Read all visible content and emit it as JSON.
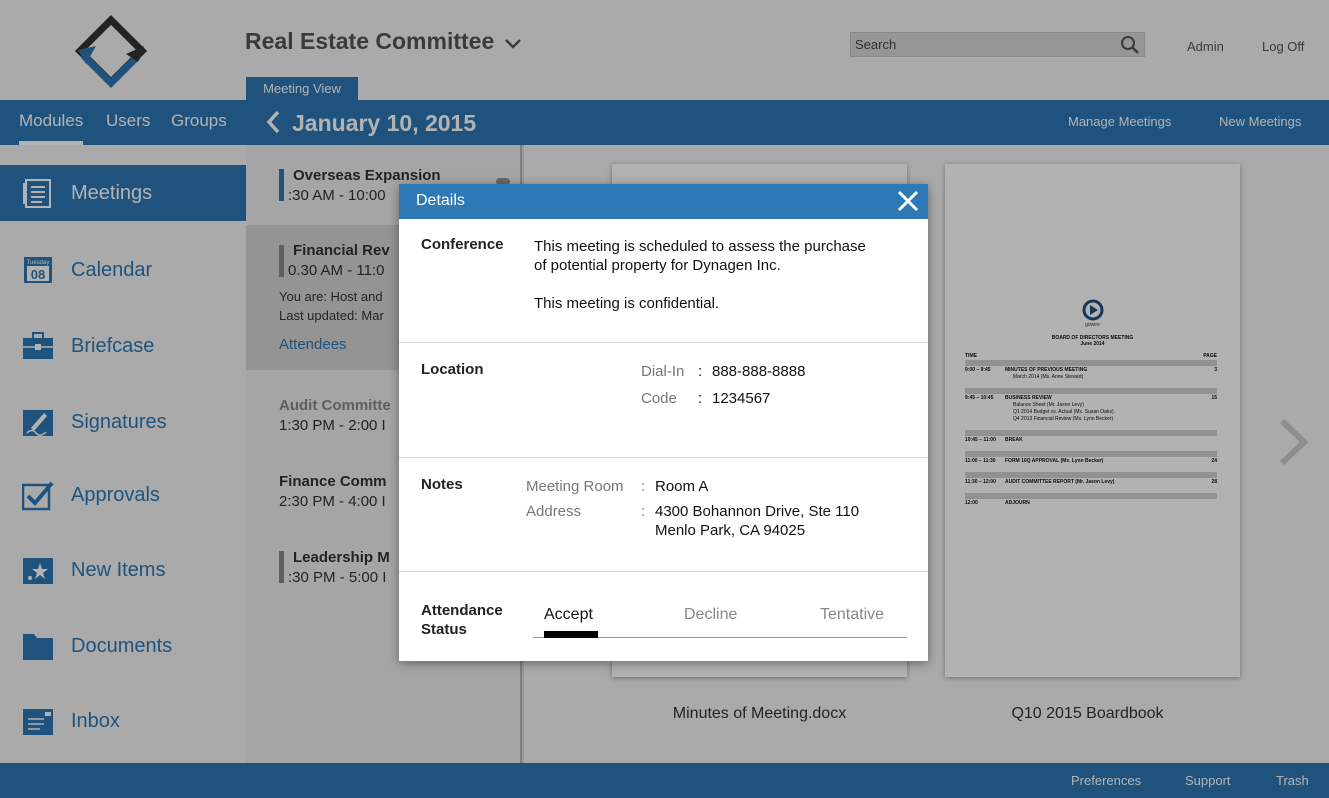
{
  "header": {
    "committee_name": "Real Estate Committee",
    "search_placeholder": "Search",
    "admin_label": "Admin",
    "logoff_label": "Log Off",
    "meeting_view_tab": "Meeting View"
  },
  "nav": {
    "tabs": [
      {
        "label": "Modules",
        "active": true
      },
      {
        "label": "Users",
        "active": false
      },
      {
        "label": "Groups",
        "active": false
      }
    ],
    "date_title": "January 10, 2015",
    "manage_meetings": "Manage Meetings",
    "new_meetings": "New Meetings"
  },
  "sidebar": {
    "items": [
      {
        "label": "Meetings",
        "icon": "meetings-icon",
        "active": true
      },
      {
        "label": "Calendar",
        "icon": "calendar-icon",
        "active": false,
        "icon_text_top": "Tuesday",
        "icon_text_day": "08"
      },
      {
        "label": "Briefcase",
        "icon": "briefcase-icon",
        "active": false
      },
      {
        "label": "Signatures",
        "icon": "signature-icon",
        "active": false
      },
      {
        "label": "Approvals",
        "icon": "approvals-icon",
        "active": false
      },
      {
        "label": "New Items",
        "icon": "new-items-icon",
        "active": false
      },
      {
        "label": "Documents",
        "icon": "documents-icon",
        "active": false
      },
      {
        "label": "Inbox",
        "icon": "inbox-icon",
        "active": false
      }
    ]
  },
  "meetings": {
    "items": [
      {
        "title": "Overseas Expansion",
        "time": ":30 AM - 10:00"
      },
      {
        "title": "Financial Rev",
        "time": "0.30 AM - 11:0",
        "host": "You are: Host and",
        "updated": "Last updated: Mar",
        "attendees": "Attendees"
      },
      {
        "title": "Audit Committe",
        "time": "1:30 PM - 2:00 I"
      },
      {
        "title": "Finance Comm",
        "time": "2:30 PM - 4:00 I"
      },
      {
        "title": "Leadership M",
        "time": ":30 PM - 5:00 I"
      }
    ]
  },
  "documents": {
    "items": [
      {
        "caption": "Minutes of Meeting.docx"
      },
      {
        "caption": "Q10 2015 Boardbook"
      }
    ],
    "boardbook": {
      "brand": "gowire",
      "title": "BOARD OF DIRECTORS MEETING",
      "date": "June 2014",
      "col_time": "TIME",
      "col_page": "PAGE",
      "rows": [
        {
          "time": "9:00 – 9:45",
          "title": "MINUTES OF PREVIOUS MEETING",
          "page": "3",
          "subs": [
            "March 2014 (Ms. Anne Stewart)"
          ]
        },
        {
          "time": "9:45 – 10:45",
          "title": "BUSINESS REVIEW",
          "page": "15",
          "subs": [
            "Balance Sheet (Mr. Jason Levy)",
            "Q1 2014 Budget vs. Actual (Ms. Susan Oaks)",
            "Q4 2013 Financial Review (Ms. Lynn Becker)"
          ]
        },
        {
          "time": "10:45 – 11:00",
          "title": "BREAK",
          "page": "",
          "subs": []
        },
        {
          "time": "11:00 – 11:30",
          "title": "FORM 10Q APPROVAL (Ms. Lynn Becker)",
          "page": "24",
          "subs": []
        },
        {
          "time": "11:30 – 12:00",
          "title": "AUDIT COMMITTEE REPORT (Mr. Jason Levy)",
          "page": "28",
          "subs": []
        },
        {
          "time": "12:00",
          "title": "ADJOURN",
          "page": "",
          "subs": []
        }
      ]
    }
  },
  "dialog": {
    "title": "Details",
    "conference": {
      "label": "Conference",
      "line1": "This meeting is scheduled to assess the purchase",
      "line2": "of potential property for Dynagen Inc.",
      "line3": "This meeting is confidential."
    },
    "location": {
      "label": "Location",
      "dialin_key": "Dial-In",
      "dialin_value": "888-888-8888",
      "code_key": "Code",
      "code_value": "1234567",
      "sep": ":"
    },
    "notes": {
      "label": "Notes",
      "room_key": "Meeting Room",
      "room_value": "Room A",
      "address_key": "Address",
      "address_line1": "4300 Bohannon Drive, Ste 110",
      "address_line2": "Menlo Park, CA 94025",
      "sep": ":"
    },
    "attendance": {
      "label_line1": "Attendance",
      "label_line2": "Status",
      "options": [
        {
          "label": "Accept",
          "active": true
        },
        {
          "label": "Decline",
          "active": false
        },
        {
          "label": "Tentative",
          "active": false
        }
      ]
    }
  },
  "footer": {
    "preferences": "Preferences",
    "support": "Support",
    "trash": "Trash"
  },
  "colors": {
    "brand_blue": "#2d78b5",
    "logo_dark": "#333333"
  }
}
